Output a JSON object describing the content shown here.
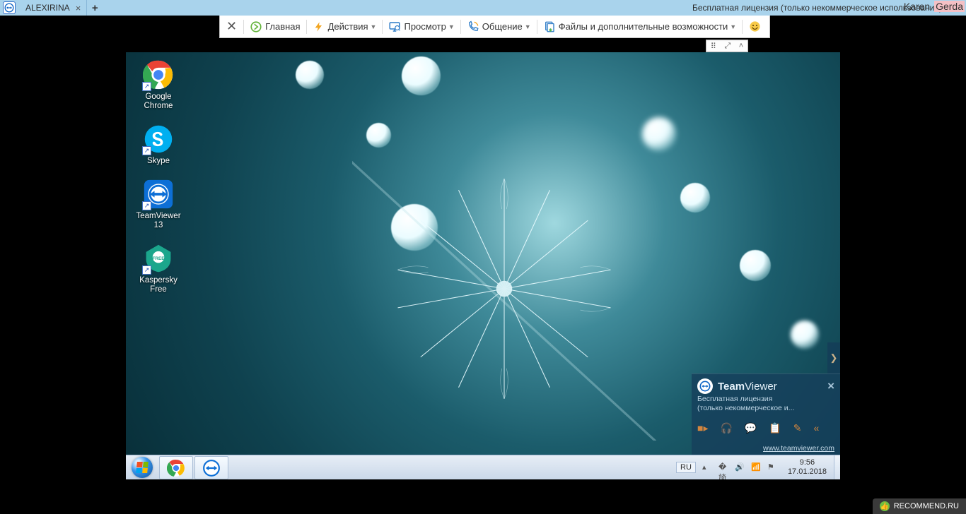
{
  "top": {
    "tab_name": "ALEXIRINA",
    "license_text": "Бесплатная лицензия (только некоммерческое использование)",
    "watermark_plain": "Karen ",
    "watermark_hl": "Gerda"
  },
  "toolbar": {
    "home": "Главная",
    "actions": "Действия",
    "view": "Просмотр",
    "comm": "Общение",
    "files": "Файлы и дополнительные возможности"
  },
  "desktop": {
    "icons": [
      {
        "label": "Google Chrome"
      },
      {
        "label": "Skype"
      },
      {
        "label": "TeamViewer 13"
      },
      {
        "label": "Kaspersky Free"
      }
    ]
  },
  "tv_panel": {
    "title": "TeamViewer",
    "sub1": "Бесплатная лицензия",
    "sub2": "(только некоммерческое и...",
    "link": "www.teamviewer.com"
  },
  "taskbar": {
    "lang": "RU",
    "time": "9:56",
    "date": "17.01.2018"
  },
  "footer": {
    "site": "RECOMMEND.RU"
  }
}
